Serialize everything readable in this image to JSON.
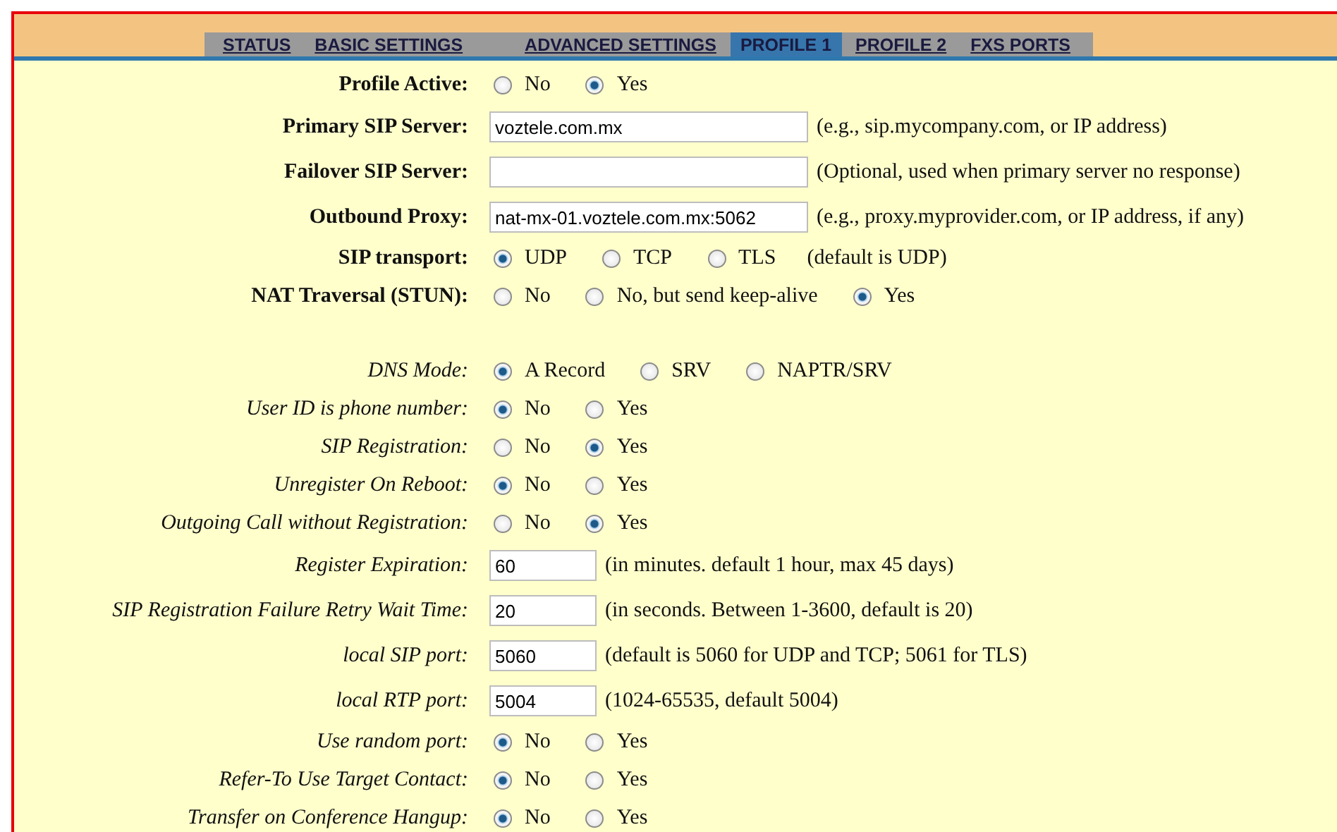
{
  "tabs": [
    {
      "label": "STATUS",
      "selected": false
    },
    {
      "label": "BASIC SETTINGS",
      "selected": false
    },
    {
      "label": "ADVANCED SETTINGS",
      "selected": false
    },
    {
      "label": "PROFILE 1",
      "selected": true
    },
    {
      "label": "PROFILE 2",
      "selected": false
    },
    {
      "label": "FXS PORTS",
      "selected": false
    }
  ],
  "sections": [
    {
      "kind": "basic",
      "rows": [
        {
          "kind": "radio",
          "label": "Profile Active:",
          "options": [
            {
              "label": "No",
              "selected": false
            },
            {
              "label": "Yes",
              "selected": true
            }
          ]
        },
        {
          "kind": "text",
          "label": "Primary SIP Server:",
          "value": "voztele.com.mx",
          "hint": "(e.g., sip.mycompany.com, or IP address)"
        },
        {
          "kind": "text",
          "label": "Failover SIP Server:",
          "hint": "(Optional, used when primary server no response)"
        },
        {
          "kind": "text",
          "label": "Outbound Proxy:",
          "value": "nat-mx-01.voztele.com.mx:5062",
          "hint": "(e.g., proxy.myprovider.com, or IP address, if any)"
        },
        {
          "kind": "radio",
          "label": "SIP transport:",
          "options": [
            {
              "label": "UDP",
              "selected": true
            },
            {
              "label": "TCP",
              "selected": false
            },
            {
              "label": "TLS",
              "selected": false
            }
          ],
          "hint": "(default is UDP)"
        },
        {
          "kind": "radio",
          "label": "NAT Traversal (STUN):",
          "options": [
            {
              "label": "No",
              "selected": false
            },
            {
              "label": "No, but send keep-alive",
              "selected": false
            },
            {
              "label": "Yes",
              "selected": true
            }
          ]
        }
      ]
    },
    {
      "kind": "advanced",
      "rows": [
        {
          "kind": "radio",
          "label": "DNS Mode:",
          "options": [
            {
              "label": "A Record",
              "selected": true
            },
            {
              "label": "SRV",
              "selected": false
            },
            {
              "label": "NAPTR/SRV",
              "selected": false
            }
          ]
        },
        {
          "kind": "radio",
          "label": "User ID is phone number:",
          "options": [
            {
              "label": "No",
              "selected": true
            },
            {
              "label": "Yes",
              "selected": false
            }
          ]
        },
        {
          "kind": "radio",
          "label": "SIP Registration:",
          "options": [
            {
              "label": "No",
              "selected": false
            },
            {
              "label": "Yes",
              "selected": true
            }
          ]
        },
        {
          "kind": "radio",
          "label": "Unregister On Reboot:",
          "options": [
            {
              "label": "No",
              "selected": true
            },
            {
              "label": "Yes",
              "selected": false
            }
          ]
        },
        {
          "kind": "radio",
          "label": "Outgoing Call without Registration:",
          "options": [
            {
              "label": "No",
              "selected": false
            },
            {
              "label": "Yes",
              "selected": true
            }
          ]
        },
        {
          "kind": "number",
          "label": "Register Expiration:",
          "value": "60",
          "hint": "(in minutes. default 1 hour, max 45 days)"
        },
        {
          "kind": "number",
          "label": "SIP Registration Failure Retry Wait Time:",
          "value": "20",
          "hint": "(in seconds. Between 1-3600, default is 20)"
        },
        {
          "kind": "number",
          "label": "local SIP port:",
          "value": "5060",
          "hint": "(default is 5060 for UDP and TCP; 5061 for TLS)"
        },
        {
          "kind": "number",
          "label": "local RTP port:",
          "value": "5004",
          "hint": "(1024-65535, default 5004)"
        },
        {
          "kind": "radio",
          "label": "Use random port:",
          "options": [
            {
              "label": "No",
              "selected": true
            },
            {
              "label": "Yes",
              "selected": false
            }
          ]
        },
        {
          "kind": "radio",
          "label": "Refer-To Use Target Contact:",
          "options": [
            {
              "label": "No",
              "selected": true
            },
            {
              "label": "Yes",
              "selected": false
            }
          ]
        },
        {
          "kind": "radio",
          "label": "Transfer on Conference Hangup:",
          "options": [
            {
              "label": "No",
              "selected": true
            },
            {
              "label": "Yes",
              "selected": false
            }
          ]
        }
      ]
    }
  ]
}
